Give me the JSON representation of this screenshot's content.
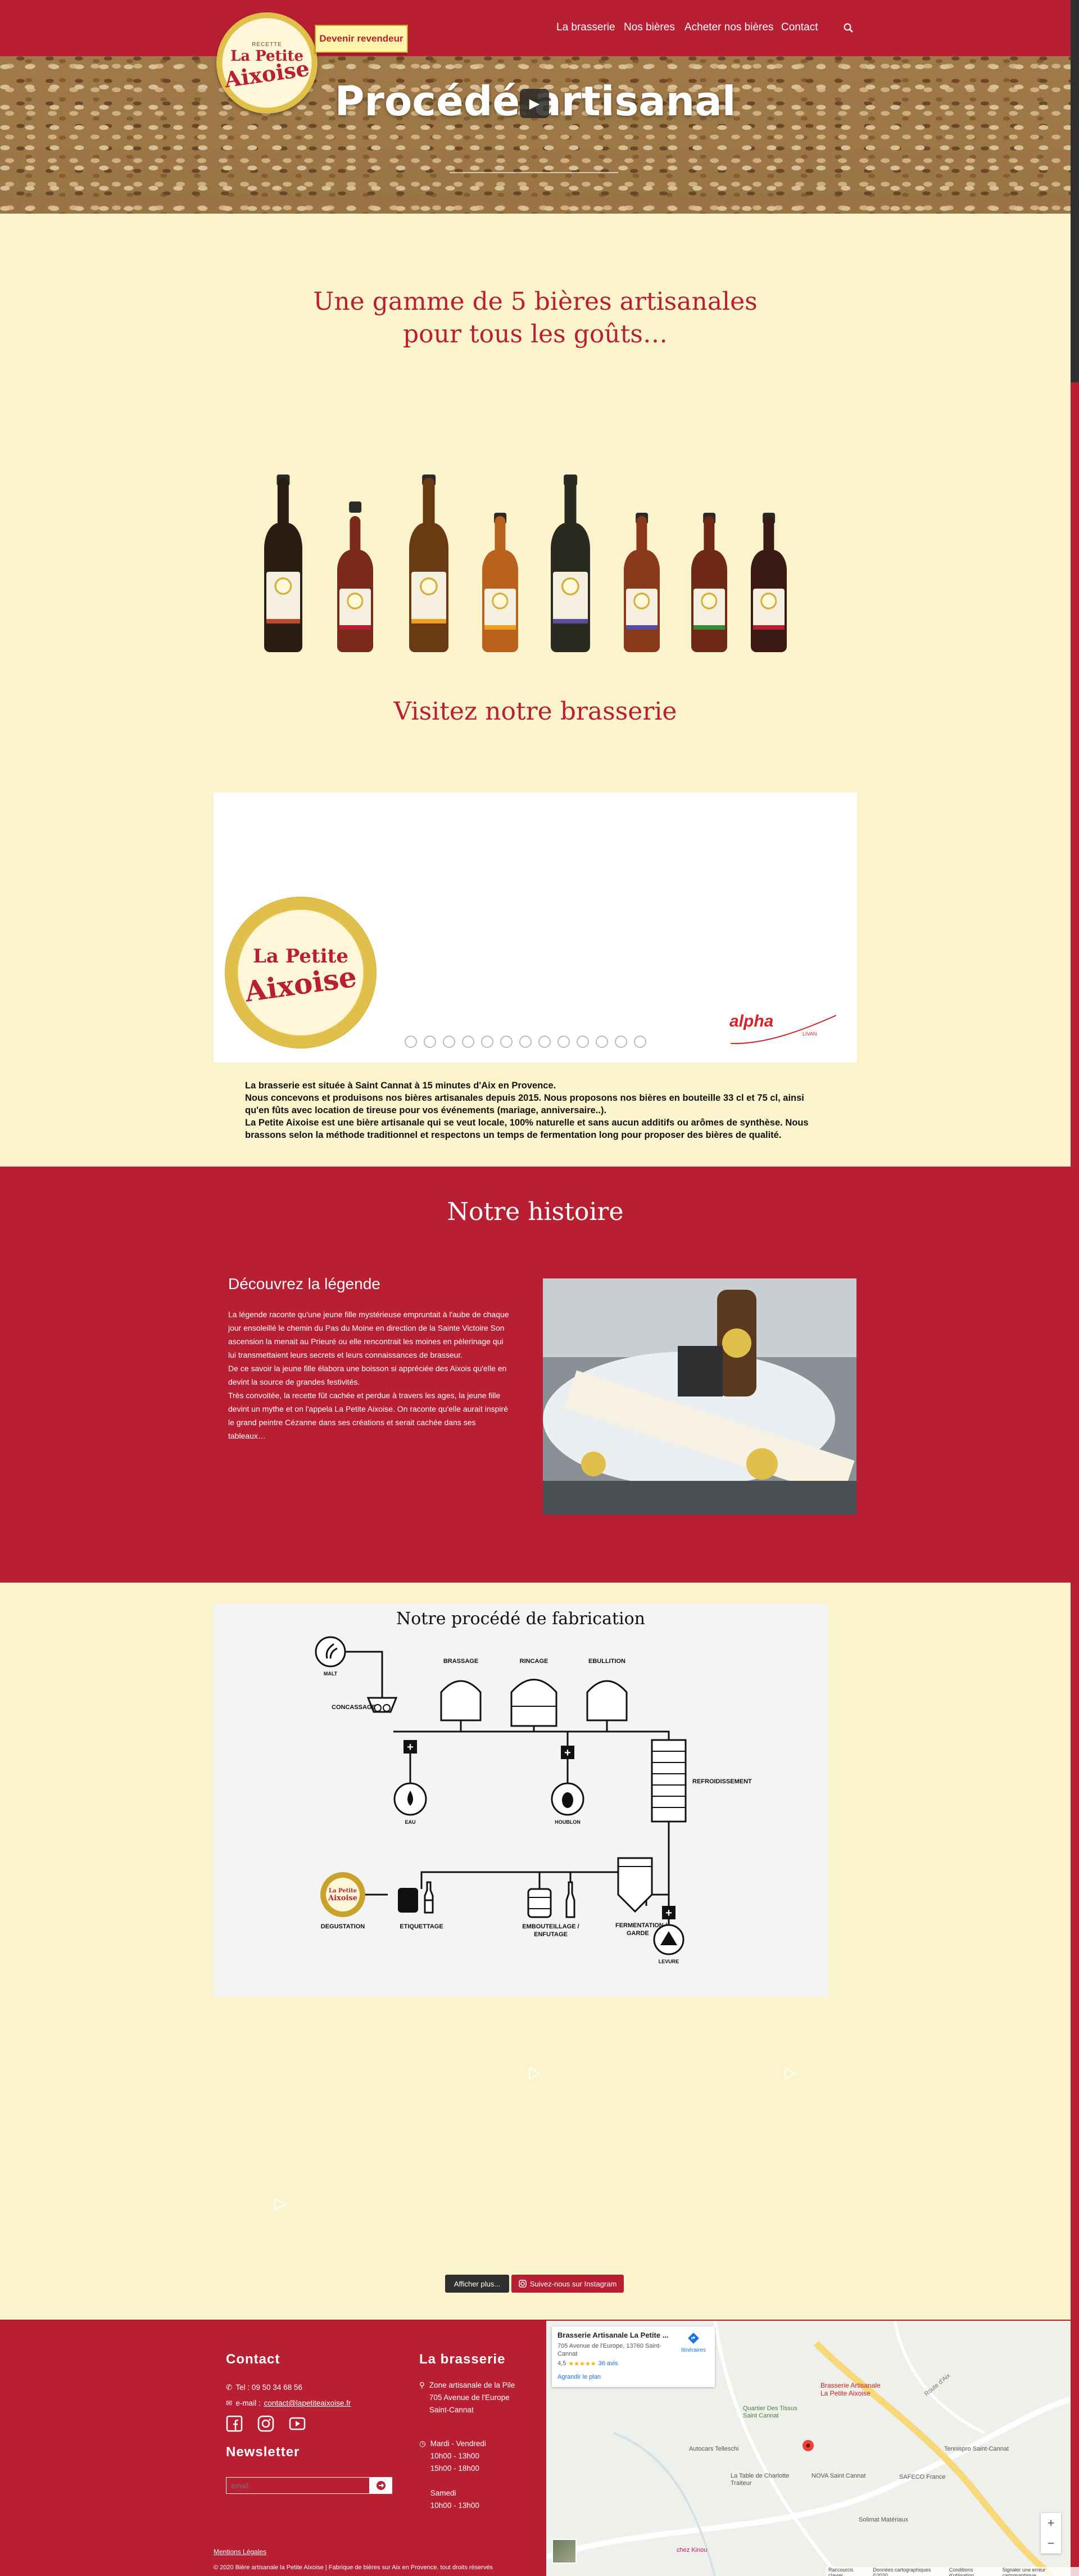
{
  "header": {
    "reseller_label": "Devenir revendeur",
    "logo": {
      "top": "RECETTE",
      "line1": "La Petite",
      "line2": "Aixoise"
    },
    "nav": [
      "La brasserie",
      "Nos bières",
      "Acheter nos bières",
      "Contact"
    ],
    "hero_title": "Procédé artisanal"
  },
  "gamme": {
    "title_line1": "Une gamme de 5 bières artisanales",
    "title_line2": "pour tous les goûts…"
  },
  "visit": {
    "title": "Visitez notre brasserie",
    "video_logo": {
      "line1": "La Petite",
      "line2": "Aixoise"
    },
    "sponsor": "alpha",
    "sponsor_sub": "LIVAN",
    "text": [
      "La brasserie est située à Saint Cannat à 15 minutes d'Aix en Provence.",
      "Nous concevons et produisons nos bières artisanales depuis 2015. Nous proposons nos bières en bouteille 33 cl et 75 cl, ainsi qu'en fûts avec location de tireuse pour vos événements (mariage, anniversaire..).",
      "La Petite Aixoise est une bière artisanale qui se veut locale, 100% naturelle et sans aucun additifs ou arômes de synthèse. Nous brassons selon la méthode traditionnel et respectons un temps de fermentation long pour proposer des bières de qualité."
    ]
  },
  "history": {
    "title": "Notre histoire",
    "subtitle": "Découvrez la légende",
    "text": [
      "La légende raconte qu'une jeune fille mystérieuse empruntait à l'aube de chaque jour ensoleillé le chemin du Pas du Moine en direction de la Sainte Victoire Son ascension la menait au Prieuré ou elle rencontrait les moines en pèlerinage qui lui transmettaient leurs secrets et leurs connaissances de brasseur.",
      "De ce savoir la jeune fille élabora une boisson si appréciée des Aixois qu'elle en devint la source de grandes festivités.",
      "Très convoitée, la recette fût cachée et perdue à travers les ages, la jeune fille devint un mythe et on l'appela La Petite Aixoise. On raconte qu'elle aurait inspiré le grand peintre Cézanne dans ses créations et serait cachée dans ses tableaux…"
    ]
  },
  "process": {
    "title": "Notre procédé de fabrication",
    "labels": {
      "malt": "MALT",
      "concassage": "CONCASSAGE",
      "brassage": "BRASSAGE",
      "rincage": "RINCAGE",
      "ebullition": "EBULLITION",
      "eau": "EAU",
      "houblon": "HOUBLON",
      "refroidissement": "REFROIDISSEMENT",
      "degustation": "DEGUSTATION",
      "etiquetage": "ETIQUETTAGE",
      "embouteillage1": "EMBOUTEILLAGE /",
      "embouteillage2": "ENFUTAGE",
      "fermentation1": "FERMENTATION /",
      "fermentation2": "GARDE",
      "levure": "LEVURE"
    }
  },
  "instagram": {
    "more_label": "Afficher plus...",
    "follow_label": "Suivez-nous sur Instagram"
  },
  "footer": {
    "contact_title": "Contact",
    "phone": "Tel : 09 50 34 68 56",
    "email_prefix": "e-mail :",
    "email": "contact@lapetiteaixoise.fr",
    "newsletter_title": "Newsletter",
    "email_placeholder": "email",
    "brasserie_title": "La brasserie",
    "address": [
      "Zone artisanale de la Pile",
      "705 Avenue de l'Europe",
      "Saint-Cannat"
    ],
    "hours": [
      "Mardi - Vendredi",
      "10h00 - 13h00",
      "15h00 - 18h00",
      "",
      "Samedi",
      "10h00 - 13h00"
    ],
    "legal": "Mentions Légales",
    "copyright": "© 2020 Bière artisanale la Petite Aixoise | Fabrique de bières sur Aix en Provence. tout droits réservés"
  },
  "map": {
    "place_name": "Brasserie Artisanale La Petite ...",
    "place_addr": "705 Avenue de l'Europe, 13760 Saint-Cannat",
    "rating": "4,5",
    "stars": "★★★★★",
    "reviews": "36 avis",
    "enlarge": "Agrandir le plan",
    "directions": "Itinéraires",
    "marker_label": "Brasserie Artisanale La Petite Aixoise",
    "pois": [
      "Quartier Des Tissus Saint Cannat",
      "Autocars Telleschi",
      "La Table de Charlotte Traiteur",
      "NOVA Saint Cannat",
      "SAFECO France",
      "Tennispro Saint-Cannat",
      "Solimat Matériaux",
      "chez Kinou",
      "Route d'Aix"
    ],
    "footer_items": [
      "Raccourcis clavier",
      "Données cartographiques ©2020",
      "Conditions d'utilisation",
      "Signaler une erreur cartographique"
    ]
  },
  "colors": {
    "brand_red": "#b91f33",
    "cream": "#fbf3cb",
    "gold": "#e0c04a"
  }
}
